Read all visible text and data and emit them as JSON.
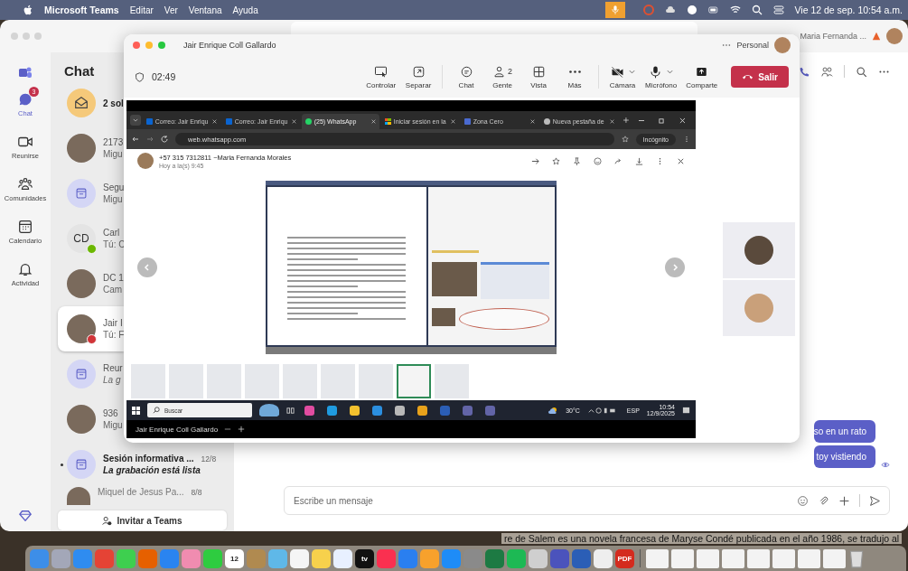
{
  "menu_bar": {
    "app": "Microsoft Teams",
    "menus": [
      "Editar",
      "Ver",
      "Ventana",
      "Ayuda"
    ],
    "clock": "Vie 12 de sep.  10:54 a.m."
  },
  "teams": {
    "rail": [
      {
        "kind": "chat",
        "label": "Chat",
        "selected": true,
        "badge": "3"
      },
      {
        "kind": "meet",
        "label": "Reunirse",
        "selected": false
      },
      {
        "kind": "communities",
        "label": "Comunidades",
        "selected": false
      },
      {
        "kind": "calendar",
        "label": "Calendario",
        "selected": false
      },
      {
        "kind": "activity",
        "label": "Actividad",
        "selected": false
      }
    ],
    "profile": "Maria Fernanda ...",
    "chat_title": "Chat",
    "chats": [
      {
        "kind": "envelope",
        "title": "2 sol",
        "selected": false,
        "unread": false
      },
      {
        "kind": "photo",
        "title": "2173",
        "preview": "Migu",
        "selected": false,
        "unread": false,
        "italic": false
      },
      {
        "kind": "calendar",
        "title": "Segu",
        "preview": "Migu",
        "selected": false,
        "unread": false,
        "italic": false
      },
      {
        "kind": "initials",
        "initials": "CD",
        "presence": {
          "kind": "available"
        },
        "title": "Carl",
        "preview": "Tú: C",
        "selected": false,
        "unread": false,
        "italic": false
      },
      {
        "kind": "photo",
        "title": "DC 1",
        "preview": "Cam",
        "selected": false,
        "unread": false,
        "italic": false
      },
      {
        "kind": "photo",
        "presence": {
          "kind": "busy"
        },
        "title": "Jair I",
        "preview": "Tú: F",
        "selected": true,
        "unread": false,
        "italic": false
      },
      {
        "kind": "calendar",
        "title": "Reur",
        "preview": "La g",
        "selected": false,
        "unread": false,
        "italic": true
      },
      {
        "kind": "photo",
        "title": "936",
        "preview": "Migu",
        "selected": false,
        "unread": false,
        "italic": false
      },
      {
        "kind": "calendar",
        "title": "Sesión informativa ...",
        "time": "12/8",
        "preview": "La grabación está lista",
        "selected": false,
        "unread": true,
        "italic": true
      },
      {
        "kind": "photo",
        "title": "Miquel de Jesus Pa...",
        "time": "8/8",
        "selected": false,
        "unread": false
      }
    ],
    "invite": "Invitar a Teams",
    "messages": [
      {
        "text": "so en un rato"
      },
      {
        "text": "toy vistiendo"
      }
    ],
    "compose": {
      "placeholder": "Escribe un mensaje"
    }
  },
  "call": {
    "title": "Jair Enrique Coll Gallardo",
    "account": "Personal",
    "timer": "02:49",
    "controls": [
      {
        "kind": "control",
        "label": "Controlar"
      },
      {
        "kind": "popout",
        "label": "Separar"
      },
      {
        "kind": "chat",
        "label": "Chat"
      },
      {
        "kind": "people",
        "label": "Gente",
        "count": "2"
      },
      {
        "kind": "grid",
        "label": "Vista"
      },
      {
        "kind": "more",
        "label": "Más"
      },
      {
        "kind": "camera",
        "label": "Cámara"
      },
      {
        "kind": "mic",
        "label": "Micrófono"
      },
      {
        "kind": "share",
        "label": "Comparte"
      }
    ],
    "leave": "Salir",
    "shared": {
      "tabs": [
        {
          "kind": "outlook",
          "label": "Correo: Jair Enriqu",
          "selected": false
        },
        {
          "kind": "outlook",
          "label": "Correo: Jair Enriqu",
          "selected": false
        },
        {
          "kind": "whatsapp",
          "label": "(25) WhatsApp",
          "selected": true
        },
        {
          "kind": "microsoft",
          "label": "Iniciar sesión en la",
          "selected": false
        },
        {
          "kind": "zona",
          "label": "Zona Cero",
          "selected": false
        },
        {
          "kind": "incognito",
          "label": "Nueva pestaña de",
          "selected": false
        }
      ],
      "url": "web.whatsapp.com",
      "incognito": "Incógnito",
      "sender": "+57 315 7312811 ~Maria Fernanda Morales",
      "sent": "Hoy a la(s) 9:45",
      "thumbnails": [
        {
          "selected": false
        },
        {
          "selected": false
        },
        {
          "selected": false
        },
        {
          "selected": false
        },
        {
          "selected": false
        },
        {
          "selected": false
        },
        {
          "selected": false
        },
        {
          "selected": true
        },
        {
          "selected": false
        }
      ],
      "search": "Buscar",
      "apps": [
        {
          "color": "#e04ca0"
        },
        {
          "color": "#1f9be0"
        },
        {
          "color": "#f2c12e"
        },
        {
          "color": "#2b8fe0"
        },
        {
          "color": "#b8b8b8"
        },
        {
          "color": "#e8a21b"
        },
        {
          "color": "#2b5eb6"
        },
        {
          "color": "#6264a7"
        },
        {
          "color": "#6264a7"
        }
      ],
      "weather": "30°C",
      "lang": "ESP",
      "time": "10:54",
      "date": "12/9/2025"
    },
    "presenter": "Jair Enrique Coll Gallardo"
  },
  "desktop_text": "re de Salem es una novela francesa de Maryse Condé publicada en el año 1986, se tradujo al",
  "dock": [
    {
      "kind": "app",
      "color": "#3d8ee8"
    },
    {
      "kind": "app",
      "color": "#a3a7b8"
    },
    {
      "kind": "app",
      "color": "#2f8cf0"
    },
    {
      "kind": "app",
      "color": "#e54335"
    },
    {
      "kind": "app",
      "color": "#3ecf4f"
    },
    {
      "kind": "app",
      "color": "#e66000"
    },
    {
      "kind": "app",
      "color": "#2a84f0"
    },
    {
      "kind": "app",
      "color": "#f08cb0"
    },
    {
      "kind": "app",
      "color": "#2ecc40"
    },
    {
      "kind": "app",
      "color": "#ffffff",
      "label": "12"
    },
    {
      "kind": "app",
      "color": "#b08a50"
    },
    {
      "kind": "app",
      "color": "#5fb8e8"
    },
    {
      "kind": "app",
      "color": "#f5f5f5"
    },
    {
      "kind": "app",
      "color": "#f7d14c"
    },
    {
      "kind": "app",
      "color": "#e8f0ff"
    },
    {
      "kind": "app",
      "color": "#111111",
      "label": "tv"
    },
    {
      "kind": "app",
      "color": "#fa3050"
    },
    {
      "kind": "app",
      "color": "#2a7ff0"
    },
    {
      "kind": "app",
      "color": "#f7a12c"
    },
    {
      "kind": "app",
      "color": "#1e8cf7"
    },
    {
      "kind": "app",
      "color": "#8a8a8a"
    },
    {
      "kind": "app",
      "color": "#1d7a43"
    },
    {
      "kind": "app",
      "color": "#1db954"
    },
    {
      "kind": "app",
      "color": "#cfcfcf"
    },
    {
      "kind": "app",
      "color": "#4b53bc"
    },
    {
      "kind": "app",
      "color": "#2b5eb6"
    },
    {
      "kind": "app",
      "color": "#eeeeee"
    },
    {
      "kind": "app",
      "color": "#d42b1e",
      "label": "PDF"
    },
    {
      "kind": "document",
      "color": "#f3f3f3"
    },
    {
      "kind": "document",
      "color": "#f3f3f3"
    },
    {
      "kind": "document",
      "color": "#f3f3f3"
    },
    {
      "kind": "document",
      "color": "#f3f3f3"
    },
    {
      "kind": "document",
      "color": "#f3f3f3"
    },
    {
      "kind": "document",
      "color": "#f3f3f3"
    },
    {
      "kind": "document",
      "color": "#f3f3f3"
    },
    {
      "kind": "document",
      "color": "#f3f3f3"
    },
    {
      "kind": "trash",
      "color": "#dddddd"
    }
  ]
}
